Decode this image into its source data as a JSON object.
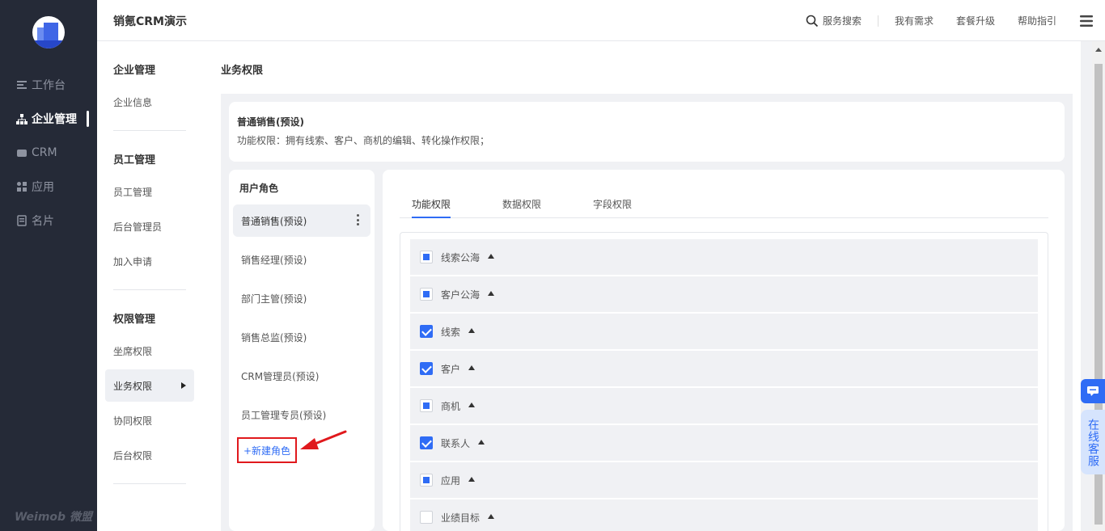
{
  "app": {
    "title": "销氪CRM演示",
    "brand": "Weimob 微盟"
  },
  "header": {
    "search": "服务搜索",
    "needs": "我有需求",
    "upgrade": "套餐升级",
    "help": "帮助指引"
  },
  "rail": {
    "items": [
      {
        "label": "工作台",
        "icon": "list-icon"
      },
      {
        "label": "企业管理",
        "icon": "org-icon"
      },
      {
        "label": "CRM",
        "icon": "crm-icon"
      },
      {
        "label": "应用",
        "icon": "apps-icon"
      },
      {
        "label": "名片",
        "icon": "card-icon"
      }
    ],
    "active": "企业管理"
  },
  "subnav": {
    "groups": [
      {
        "title": "企业管理",
        "items": [
          "企业信息"
        ]
      },
      {
        "title": "员工管理",
        "items": [
          "员工管理",
          "后台管理员",
          "加入申请"
        ]
      },
      {
        "title": "权限管理",
        "items": [
          "坐席权限",
          "业务权限",
          "协同权限",
          "后台权限"
        ]
      }
    ],
    "active": "业务权限"
  },
  "page": {
    "title": "业务权限",
    "role_card": {
      "name": "普通销售(预设)",
      "desc": "功能权限：拥有线索、客户、商机的编辑、转化操作权限；"
    },
    "roles": {
      "title": "用户角色",
      "items": [
        "普通销售(预设)",
        "销售经理(预设)",
        "部门主管(预设)",
        "销售总监(预设)",
        "CRM管理员(预设)",
        "员工管理专员(预设)"
      ],
      "active": "普通销售(预设)",
      "new_role": "+新建角色"
    },
    "tabs": [
      "功能权限",
      "数据权限",
      "字段权限"
    ],
    "active_tab": "功能权限",
    "permissions": [
      {
        "label": "线索公海",
        "state": "partial"
      },
      {
        "label": "客户公海",
        "state": "partial"
      },
      {
        "label": "线索",
        "state": "checked"
      },
      {
        "label": "客户",
        "state": "checked"
      },
      {
        "label": "商机",
        "state": "partial"
      },
      {
        "label": "联系人",
        "state": "checked"
      },
      {
        "label": "应用",
        "state": "partial"
      },
      {
        "label": "业绩目标",
        "state": "unchecked"
      }
    ]
  },
  "float": {
    "service": "在线客服"
  },
  "colors": {
    "accent": "#2f6cf5",
    "rail_bg": "#252a37",
    "highlight": "#e0191d"
  }
}
